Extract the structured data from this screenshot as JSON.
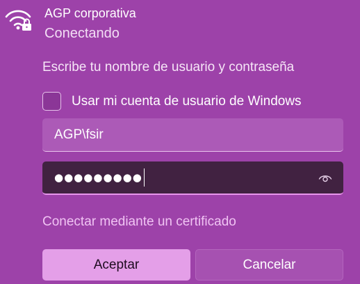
{
  "network": {
    "name": "AGP corporativa",
    "status": "Conectando",
    "icon": "wifi-lock-icon"
  },
  "prompt": "Escribe tu nombre de usuario y contraseña",
  "use_windows_account": {
    "label": "Usar mi cuenta de usuario de Windows",
    "checked": false
  },
  "username": {
    "value": "AGP\\fsir"
  },
  "password": {
    "masked_value": "●●●●●●●●●",
    "reveal_icon": "eye-icon"
  },
  "certificate_link": "Conectar mediante un certificado",
  "buttons": {
    "accept": "Aceptar",
    "cancel": "Cancelar"
  },
  "colors": {
    "background": "#9d42a9",
    "accent": "#e49fe8",
    "link": "#f0c3f3",
    "password_field": "#412241"
  }
}
